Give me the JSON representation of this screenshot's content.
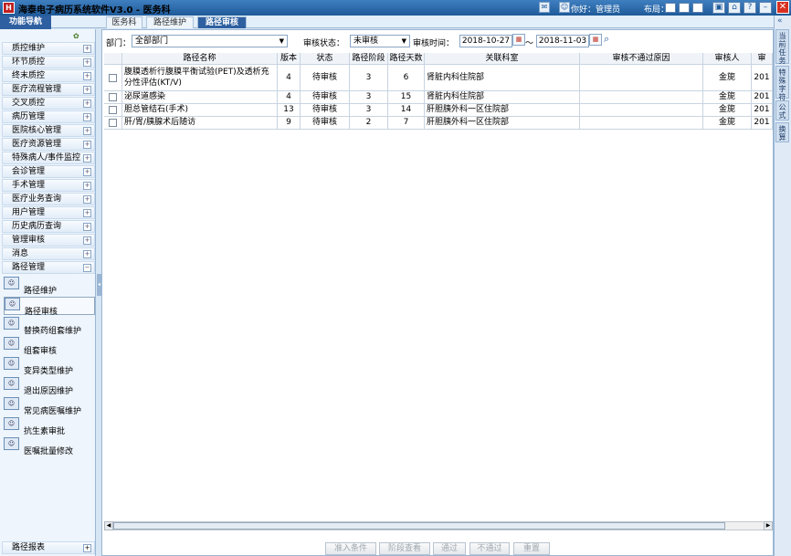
{
  "app": {
    "title": "海泰电子病历系统软件V3.0 - 医务科",
    "logo_text": "H"
  },
  "titlebar": {
    "greeting": "你好：管理员",
    "layout_label": "布局："
  },
  "sidebar": {
    "header": "功能导航",
    "groups": [
      "质控维护",
      "环节质控",
      "终末质控",
      "医疗流程管理",
      "交叉质控",
      "病历管理",
      "医院核心管理",
      "医疗资源管理",
      "特殊病人/事件监控",
      "会诊管理",
      "手术管理",
      "医疗业务查询",
      "用户管理",
      "历史病历查询",
      "管理审核",
      "消息",
      "路径管理"
    ],
    "expander_plus": "+",
    "expander_minus": "−",
    "subitems": [
      "路径维护",
      "路径审核",
      "替换药组套维护",
      "组套审核",
      "变异类型维护",
      "退出原因维护",
      "常见病医嘱维护",
      "抗生素审批",
      "医嘱批量修改"
    ],
    "footer": "路径报表"
  },
  "tabs": [
    "医务科",
    "路径维护",
    "路径审核"
  ],
  "filters": {
    "dept_label": "部门：",
    "dept_value": "全部部门",
    "status_label": "审核状态：",
    "status_value": "未审核",
    "time_label": "审核时间：",
    "date_from": "2018-10-27",
    "tilde": "～",
    "date_to": "2018-11-03"
  },
  "grid": {
    "columns": [
      "路径名称",
      "版本",
      "状态",
      "路径阶段",
      "路径天数",
      "关联科室",
      "审核不通过原因",
      "审核人",
      "审"
    ],
    "rows": [
      {
        "name": "腹膜透析行腹膜平衡试验(PET)及透析充分性评估(KT/V)",
        "version": "4",
        "status": "待审核",
        "stage": "3",
        "days": "6",
        "dept": "肾脏内科住院部",
        "reason": "",
        "reviewer": "金旎",
        "time": "201"
      },
      {
        "name": "泌尿道感染",
        "version": "4",
        "status": "待审核",
        "stage": "3",
        "days": "15",
        "dept": "肾脏内科住院部",
        "reason": "",
        "reviewer": "金旎",
        "time": "201"
      },
      {
        "name": "胆总管结石(手术)",
        "version": "13",
        "status": "待审核",
        "stage": "3",
        "days": "14",
        "dept": "肝胆胰外科一区住院部",
        "reason": "",
        "reviewer": "金旎",
        "time": "201"
      },
      {
        "name": "肝/胃/胰腺术后随访",
        "version": "9",
        "status": "待审核",
        "stage": "2",
        "days": "7",
        "dept": "肝胆胰外科一区住院部",
        "reason": "",
        "reviewer": "金旎",
        "time": "201"
      }
    ]
  },
  "buttons": [
    "准入条件",
    "阶段查看",
    "通过",
    "不通过",
    "重置"
  ],
  "rightstrip": {
    "collapse": "«",
    "tabs": [
      "当前任务",
      "特殊字符",
      "公式",
      "换算"
    ]
  },
  "colors": {
    "accent": "#2e5fa0",
    "close": "#d83020"
  }
}
